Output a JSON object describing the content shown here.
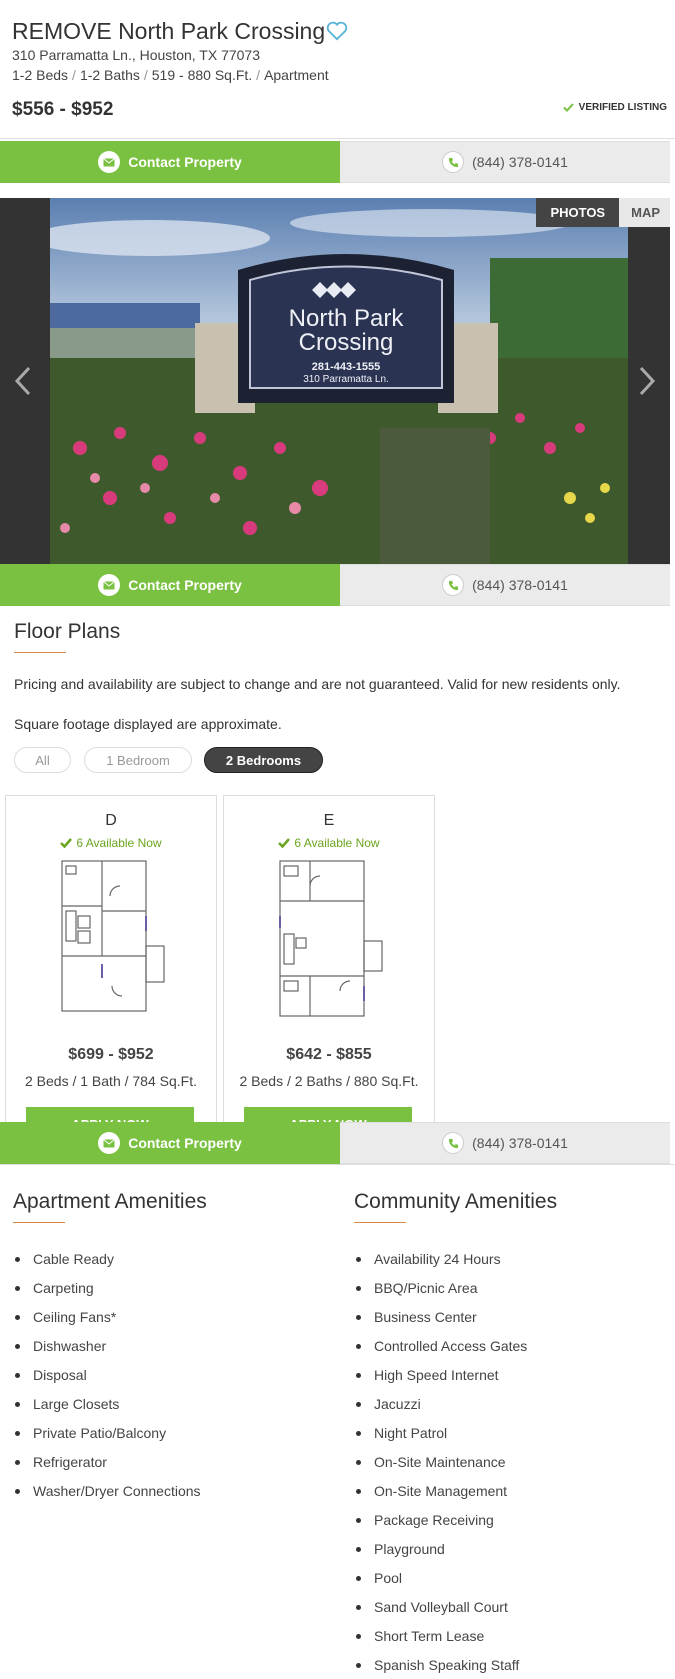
{
  "header": {
    "title": "REMOVE North Park Crossing",
    "address": "310 Parramatta Ln., Houston, TX 77073",
    "specs": [
      "1-2 Beds",
      "1-2 Baths",
      "519 - 880 Sq.Ft.",
      "Apartment"
    ],
    "price": "$556 - $952",
    "verified": "VERIFIED LISTING"
  },
  "cta": {
    "contact_label": "Contact Property",
    "phone": "(844) 378-0141"
  },
  "gallery": {
    "tab_photos": "PHOTOS",
    "tab_map": "MAP",
    "sign": {
      "line1": "North Park",
      "line2": "Crossing",
      "phone": "281-443-1555",
      "address": "310 Parramatta Ln."
    }
  },
  "floor_plans": {
    "title": "Floor Plans",
    "disclaimer": "Pricing and availability are subject to change and are not guaranteed. Valid for new residents only.",
    "sqft_note": "Square footage displayed are approximate.",
    "filters": [
      {
        "label": "All",
        "active": false
      },
      {
        "label": "1 Bedroom",
        "active": false
      },
      {
        "label": "2 Bedrooms",
        "active": true
      }
    ],
    "plans": [
      {
        "name": "D",
        "availability": "6 Available Now",
        "price": "$699 - $952",
        "specs": "2 Beds /  1 Bath /  784 Sq.Ft.",
        "apply": "APPLY NOW"
      },
      {
        "name": "E",
        "availability": "6 Available Now",
        "price": "$642 - $855",
        "specs": "2 Beds /  2 Baths /  880 Sq.Ft.",
        "apply": "APPLY NOW"
      }
    ]
  },
  "apartment_amenities": {
    "title": "Apartment Amenities",
    "items": [
      "Cable Ready",
      "Carpeting",
      "Ceiling Fans*",
      "Dishwasher",
      "Disposal",
      "Large Closets",
      "Private Patio/Balcony",
      "Refrigerator",
      "Washer/Dryer Connections"
    ]
  },
  "community_amenities": {
    "title": "Community Amenities",
    "items": [
      "Availability 24 Hours",
      "BBQ/Picnic Area",
      "Business Center",
      "Controlled Access Gates",
      "High Speed Internet",
      "Jacuzzi",
      "Night Patrol",
      "On-Site Maintenance",
      "On-Site Management",
      "Package Receiving",
      "Playground",
      "Pool",
      "Sand Volleyball Court",
      "Short Term Lease",
      "Spanish Speaking Staff"
    ]
  },
  "colors": {
    "accent_green": "#7ac142",
    "available_green": "#6aa51f",
    "heading_underline": "#d4894a"
  }
}
